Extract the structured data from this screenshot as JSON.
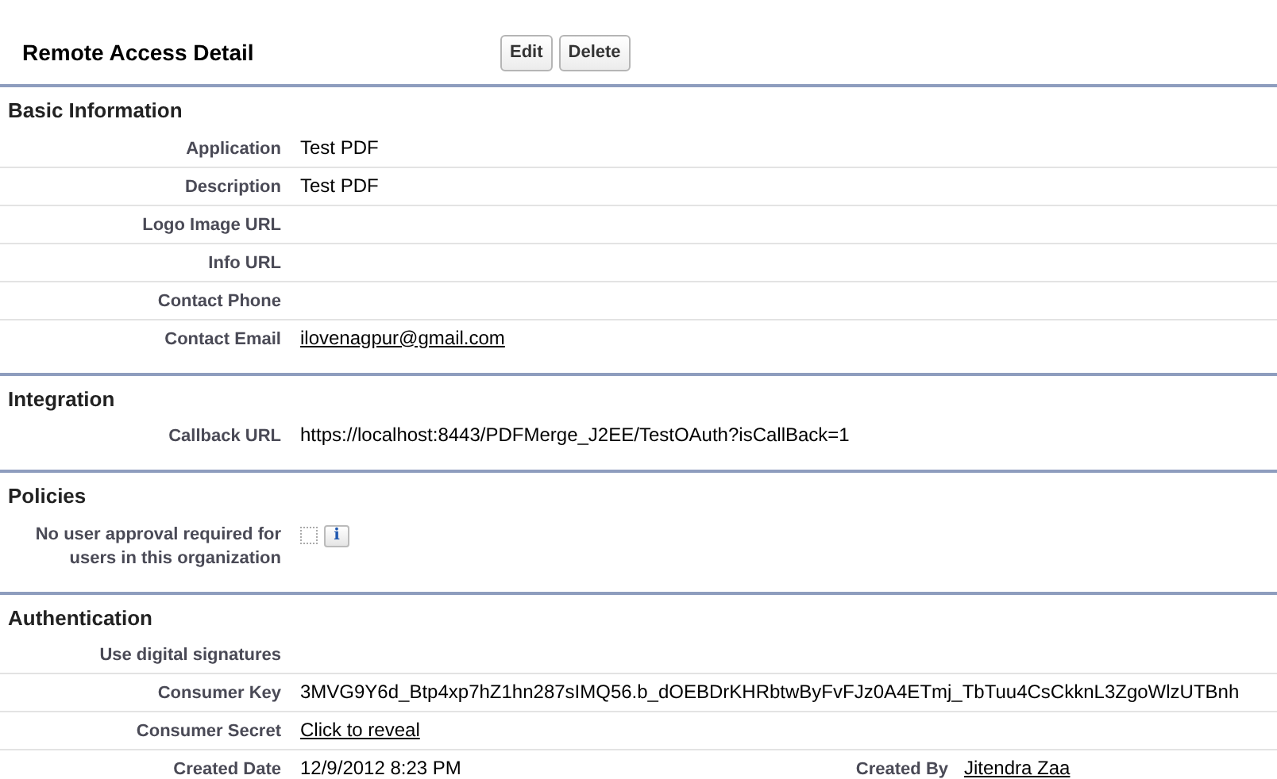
{
  "title": "Remote Access Detail",
  "buttons": [
    "Edit",
    "Delete"
  ],
  "sections": [
    {
      "title": "Basic Information",
      "rows": [
        {
          "kind": "text",
          "label": "Application",
          "value": "Test PDF"
        },
        {
          "kind": "text",
          "label": "Description",
          "value": "Test PDF"
        },
        {
          "kind": "text",
          "label": "Logo Image URL"
        },
        {
          "kind": "text",
          "label": "Info URL"
        },
        {
          "kind": "text",
          "label": "Contact Phone"
        },
        {
          "kind": "link",
          "label": "Contact Email",
          "value": "ilovenagpur@gmail.com"
        }
      ]
    },
    {
      "title": "Integration",
      "rows": [
        {
          "kind": "text",
          "label": "Callback URL",
          "value": "https://localhost:8443/PDFMerge_J2EE/TestOAuth?isCallBack=1"
        }
      ]
    },
    {
      "title": "Policies",
      "rows": [
        {
          "kind": "checkbox",
          "label": "No user approval required for users in this organization",
          "checked": false,
          "info": "i"
        }
      ]
    },
    {
      "title": "Authentication",
      "rows": [
        {
          "kind": "text",
          "label": "Use digital signatures"
        },
        {
          "kind": "text",
          "label": "Consumer Key",
          "value": "3MVG9Y6d_Btp4xp7hZ1hn287sIMQ56.b_dOEBDrKHRbtwByFvFJz0A4ETmj_TbTuu4CsCkknL3ZgoWlzUTBnh"
        },
        {
          "kind": "link",
          "label": "Consumer Secret",
          "value": "Click to reveal"
        },
        {
          "kind": "pair",
          "label": "Created Date",
          "value": "12/9/2012 8:23 PM",
          "label2": "Created By",
          "value2": "Jitendra Zaa"
        }
      ]
    }
  ]
}
